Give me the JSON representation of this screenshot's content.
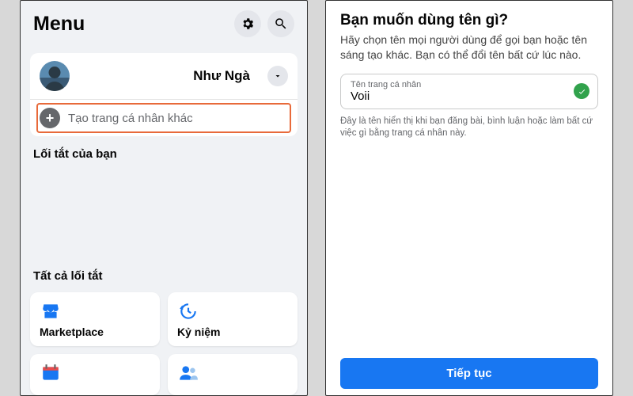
{
  "left": {
    "title": "Menu",
    "profile": {
      "name": "Như Ngà"
    },
    "create_profile_label": "Tạo trang cá nhân khác",
    "shortcuts_label": "Lối tắt của bạn",
    "all_shortcuts_label": "Tất cả lối tắt",
    "tiles": [
      {
        "label": "Marketplace"
      },
      {
        "label": "Kỷ niệm"
      },
      {
        "label": ""
      },
      {
        "label": ""
      }
    ]
  },
  "right": {
    "title": "Bạn muốn dùng tên gì?",
    "subtitle": "Hãy chọn tên mọi người dùng để gọi bạn hoặc tên sáng tạo khác. Bạn có thể đổi tên bất cứ lúc nào.",
    "input_label": "Tên trang cá nhân",
    "input_value": "Voii",
    "help_text": "Đây là tên hiển thị khi bạn đăng bài, bình luận hoặc làm bất cứ việc gì bằng trang cá nhân này.",
    "continue_label": "Tiếp tục"
  }
}
